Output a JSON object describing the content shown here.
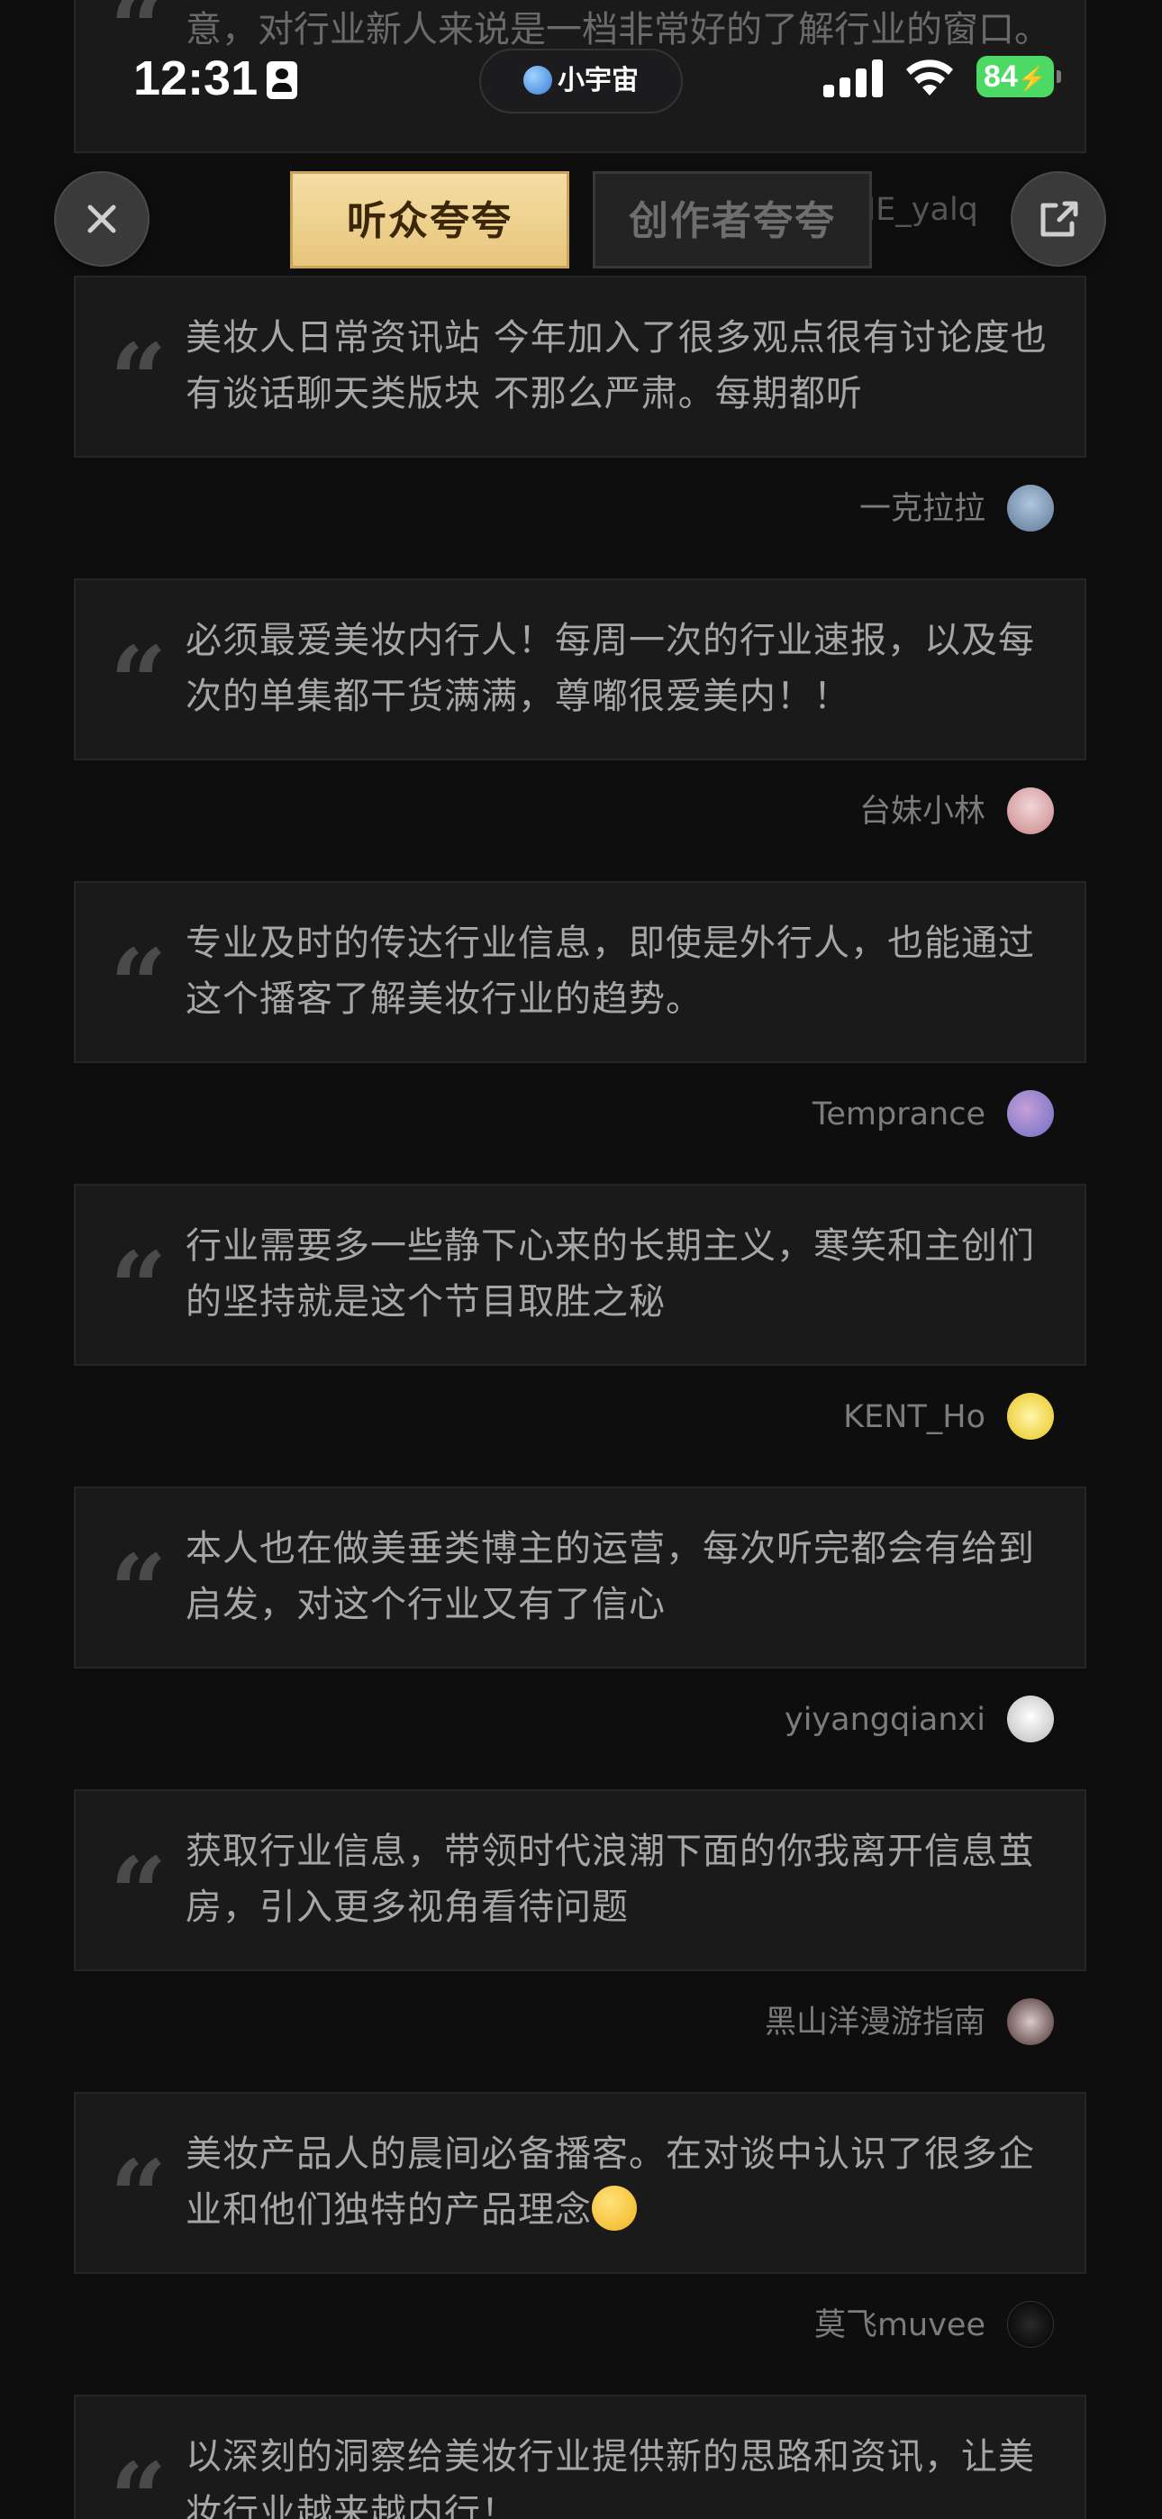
{
  "status_bar": {
    "time": "12:31",
    "island_label": "小宇宙",
    "battery": "84"
  },
  "top_partial": {
    "text": "意，对行业新人来说是一档非常好的了解行业的窗口。",
    "author_fragment": "NE_yalq"
  },
  "tabs": [
    {
      "label": "听众夸夸",
      "active": true
    },
    {
      "label": "创作者夸夸",
      "active": false
    }
  ],
  "reviews": [
    {
      "text": "美妆人日常资讯站 今年加入了很多观点很有讨论度也有谈话聊天类版块 不那么严肃。每期都听",
      "author": "一克拉拉"
    },
    {
      "text": "必须最爱美妆内行人！每周一次的行业速报，以及每次的单集都干货满满，尊嘟很爱美内！！",
      "author": "台妹小林"
    },
    {
      "text": "专业及时的传达行业信息，即使是外行人，也能通过这个播客了解美妆行业的趋势。",
      "author": "Temprance"
    },
    {
      "text": "行业需要多一些静下心来的长期主义，寒笑和主创们的坚持就是这个节目取胜之秘",
      "author": "KENT_Ho"
    },
    {
      "text": "本人也在做美垂类博主的运营，每次听完都会有给到启发，对这个行业又有了信心",
      "author": "yiyangqianxi"
    },
    {
      "text": "获取行业信息，带领时代浪潮下面的你我离开信息茧房，引入更多视角看待问题",
      "author": "黑山洋漫游指南"
    },
    {
      "text": "美妆产品人的晨间必备播客。在对谈中认识了很多企业和他们独特的产品理念",
      "author": "莫飞muvee"
    },
    {
      "text": "以深刻的洞察给美妆行业提供新的思路和资讯，让美妆行业越来越内行！",
      "author": ""
    }
  ],
  "colors": {
    "background": "#0e0e0e",
    "card": "#1a1a1a",
    "tab_active": "#f4dea4",
    "battery": "#4cd964"
  },
  "icons": [
    "close-icon",
    "share-icon",
    "quote-icon",
    "wifi-icon",
    "signal-icon",
    "battery-icon",
    "id-card-icon",
    "planet-icon"
  ]
}
